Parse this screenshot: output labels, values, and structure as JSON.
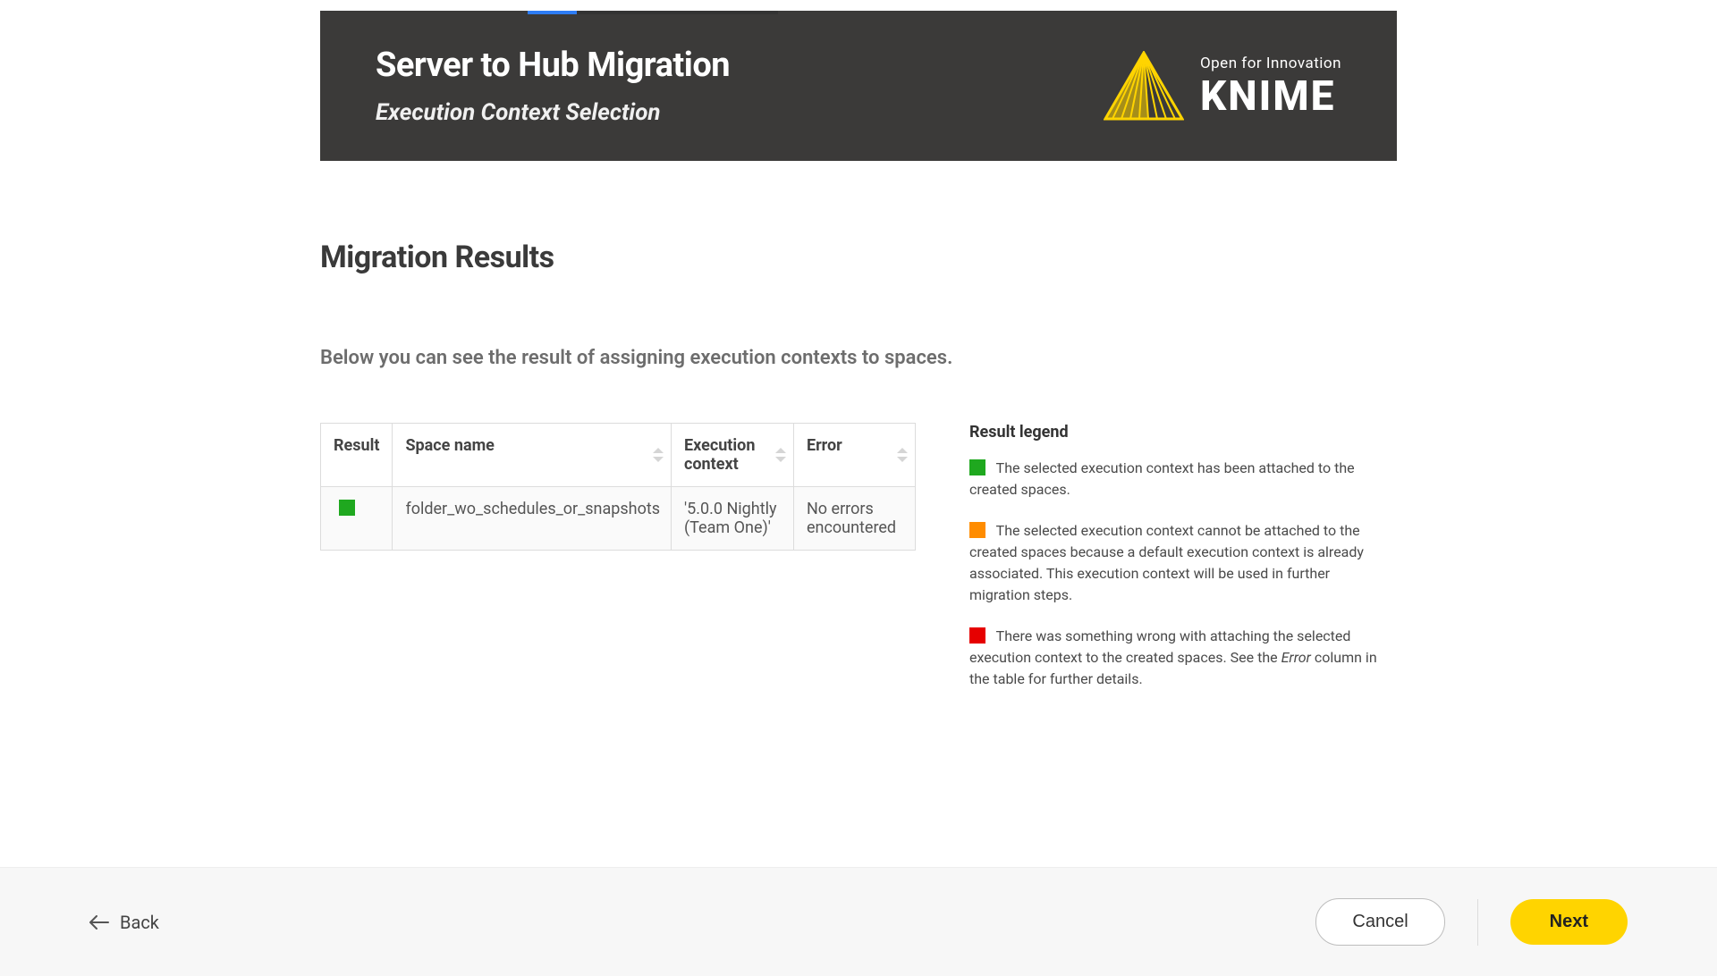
{
  "header": {
    "title": "Server to Hub Migration",
    "subtitle": "Execution Context Selection",
    "logo": {
      "tagline": "Open for Innovation",
      "brand": "KNIME",
      "accent_color": "#ffd400"
    }
  },
  "section": {
    "title": "Migration Results",
    "description": "Below you can see the result of assigning execution contexts to spaces."
  },
  "table": {
    "columns": {
      "result": "Result",
      "space_name": "Space name",
      "execution_context": "Execution context",
      "error": "Error"
    },
    "rows": [
      {
        "status_color": "#1fa81f",
        "space_name": "folder_wo_schedules_or_snapshots",
        "execution_context": "'5.0.0 Nightly (Team One)'",
        "error": "No errors encountered"
      }
    ]
  },
  "legend": {
    "title": "Result legend",
    "items": [
      {
        "color": "#1fa81f",
        "text": "The selected execution context has been attached to the created spaces."
      },
      {
        "color": "#ff8c00",
        "text": "The selected execution context cannot be attached to the created spaces because a default execution context is already associated. This execution context will be used in further migration steps."
      },
      {
        "color": "#e60000",
        "text_before": "There was something wrong with attaching the selected execution context to the created spaces. See the ",
        "italic": "Error",
        "text_after": " column in the table for further details."
      }
    ]
  },
  "footer": {
    "back": "Back",
    "cancel": "Cancel",
    "next": "Next"
  }
}
